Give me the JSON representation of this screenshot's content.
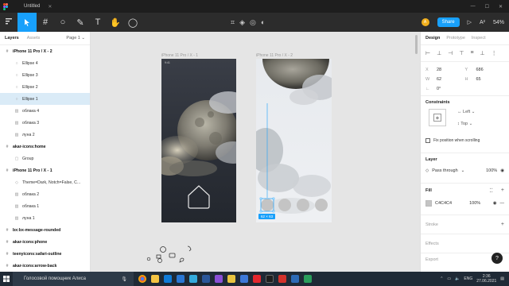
{
  "app": {
    "tab_title": "Untitled",
    "zoom": "54%"
  },
  "toolbar": {
    "share_label": "Share",
    "avatar_initial": "A",
    "aa_label": "A²"
  },
  "left_panel": {
    "tab_layers": "Layers",
    "tab_assets": "Assets",
    "page_label": "Page 1",
    "rows": [
      {
        "label": "iPhone 11 Pro / X - 2",
        "indent": 0,
        "icon": "#",
        "bold": true,
        "selected": false
      },
      {
        "label": "Ellipse 4",
        "indent": 1,
        "icon": "○",
        "bold": false,
        "selected": false
      },
      {
        "label": "Ellipse 3",
        "indent": 1,
        "icon": "○",
        "bold": false,
        "selected": false
      },
      {
        "label": "Ellipse 2",
        "indent": 1,
        "icon": "○",
        "bold": false,
        "selected": false
      },
      {
        "label": "Ellipse 1",
        "indent": 1,
        "icon": "○",
        "bold": false,
        "selected": true
      },
      {
        "label": "облака 4",
        "indent": 1,
        "icon": "▨",
        "bold": false,
        "selected": false
      },
      {
        "label": "облака 3",
        "indent": 1,
        "icon": "▨",
        "bold": false,
        "selected": false
      },
      {
        "label": "луна 2",
        "indent": 1,
        "icon": "▨",
        "bold": false,
        "selected": false
      },
      {
        "label": "akar-icons:home",
        "indent": 0,
        "icon": "#",
        "bold": true,
        "selected": false
      },
      {
        "label": "Group",
        "indent": 1,
        "icon": "▢",
        "bold": false,
        "selected": false
      },
      {
        "label": "iPhone 11 Pro / X - 1",
        "indent": 0,
        "icon": "#",
        "bold": true,
        "selected": false
      },
      {
        "label": "Theme=Dark, Notch=False, C...",
        "indent": 1,
        "icon": "◇",
        "bold": false,
        "selected": false
      },
      {
        "label": "облака 2",
        "indent": 1,
        "icon": "▨",
        "bold": false,
        "selected": false
      },
      {
        "label": "облака 1",
        "indent": 1,
        "icon": "▨",
        "bold": false,
        "selected": false
      },
      {
        "label": "луна 1",
        "indent": 1,
        "icon": "▨",
        "bold": false,
        "selected": false
      },
      {
        "label": "bx:bx-message-rounded",
        "indent": 0,
        "icon": "#",
        "bold": true,
        "selected": false
      },
      {
        "label": "akar-icons:phone",
        "indent": 0,
        "icon": "#",
        "bold": true,
        "selected": false
      },
      {
        "label": "teenyicons:safari-outline",
        "indent": 0,
        "icon": "#",
        "bold": true,
        "selected": false
      },
      {
        "label": "akar-icons:arrow-back",
        "indent": 0,
        "icon": "#",
        "bold": true,
        "selected": false
      }
    ]
  },
  "canvas": {
    "frame1_label": "iPhone 11 Pro / X - 1",
    "frame2_label": "iPhone 11 Pro / X - 2",
    "status_time": "9:41",
    "selection_size": "62 × 63"
  },
  "right_panel": {
    "tab_design": "Design",
    "tab_prototype": "Prototype",
    "tab_inspect": "Inspect",
    "x_label": "X",
    "x_value": "28",
    "y_label": "Y",
    "y_value": "686",
    "w_label": "W",
    "w_value": "62",
    "h_label": "H",
    "h_value": "65",
    "rotation": "0°",
    "constraints_title": "Constraints",
    "constraint_h": "Left",
    "constraint_v": "Top",
    "fix_position_label": "Fix position when scrolling",
    "layer_title": "Layer",
    "blend_mode": "Pass through",
    "opacity": "100%",
    "fill_title": "Fill",
    "fill_hex": "C4C4C4",
    "fill_opacity": "100%",
    "fill_color": "#c4c4c4",
    "stroke_title": "Stroke",
    "effects_title": "Effects",
    "export_title": "Export",
    "help": "?"
  },
  "taskbar": {
    "search_text": "Голосовой помощник Алиса",
    "lang": "ENG",
    "time": "2:36",
    "date": "27.06.2021"
  },
  "colors": {
    "accent": "#18a0fb",
    "toolbar_bg": "#2c2c2c",
    "taskbar_bg": "#1f2a36"
  }
}
